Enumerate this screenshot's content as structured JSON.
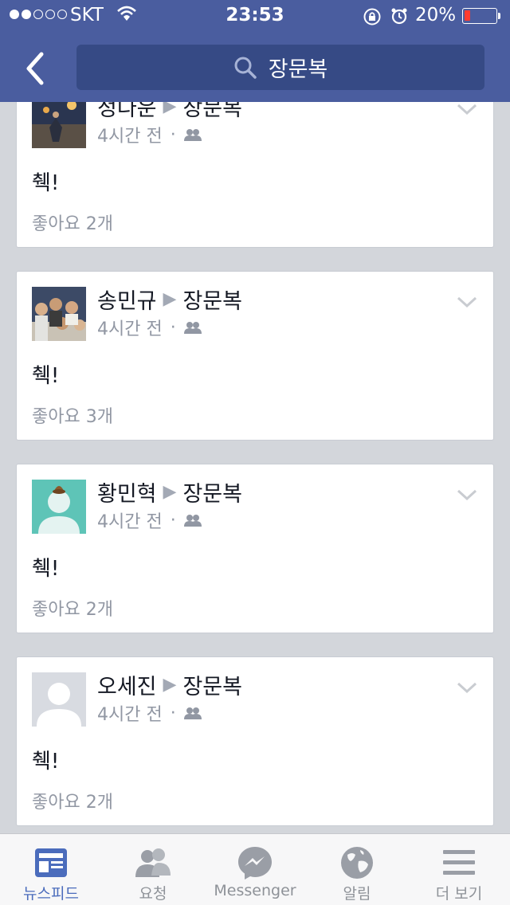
{
  "status_bar": {
    "carrier": "SKT",
    "time": "23:53",
    "battery": "20%",
    "battery_level": 0.2
  },
  "search": {
    "query": "장문복"
  },
  "posts": [
    {
      "author": "정다운",
      "target": "장문복",
      "time": "4시간 전",
      "text": "췍!",
      "likes": "좋아요 2개"
    },
    {
      "author": "송민규",
      "target": "장문복",
      "time": "4시간 전",
      "text": "췍!",
      "likes": "좋아요 3개"
    },
    {
      "author": "황민혁",
      "target": "장문복",
      "time": "4시간 전",
      "text": "췍!",
      "likes": "좋아요 2개"
    },
    {
      "author": "오세진",
      "target": "장문복",
      "time": "4시간 전",
      "text": "췍!",
      "likes": "좋아요 2개"
    }
  ],
  "tabbar": {
    "items": [
      {
        "label": "뉴스피드",
        "icon": "newsfeed-icon"
      },
      {
        "label": "요청",
        "icon": "friend-requests-icon"
      },
      {
        "label": "Messenger",
        "icon": "messenger-icon"
      },
      {
        "label": "알림",
        "icon": "globe-icon"
      },
      {
        "label": "더 보기",
        "icon": "menu-icon"
      }
    ]
  },
  "colors": {
    "header": "#4a5d9f",
    "search_box": "#364a85",
    "active_tab": "#4b6cbc",
    "battery_low": "#ff3b30"
  }
}
